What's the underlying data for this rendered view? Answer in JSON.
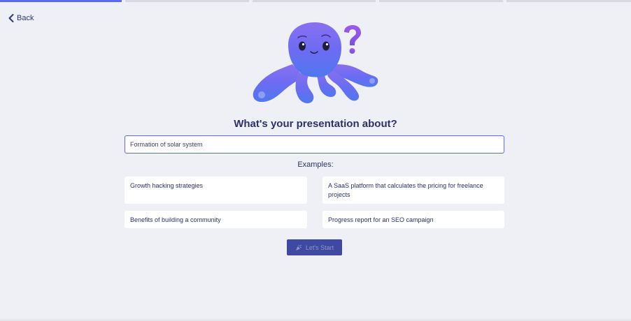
{
  "progress": {
    "total_steps": 5,
    "current_step": 1
  },
  "back": {
    "label": "Back"
  },
  "heading": "What's your presentation about?",
  "topic_input": {
    "value": "Formation of solar system"
  },
  "examples": {
    "label": "Examples:",
    "items": [
      "Growth hacking strategies",
      "A SaaS platform that calculates the pricing for freelance projects",
      "Benefits of building a community",
      "Progress report for an SEO campaign"
    ]
  },
  "start_button": {
    "label": "Let's Start",
    "icon": "party-popper-icon"
  },
  "colors": {
    "accent": "#5b6cf0",
    "button": "#3f49a2",
    "text": "#2c3169",
    "background": "#eef0f5"
  }
}
